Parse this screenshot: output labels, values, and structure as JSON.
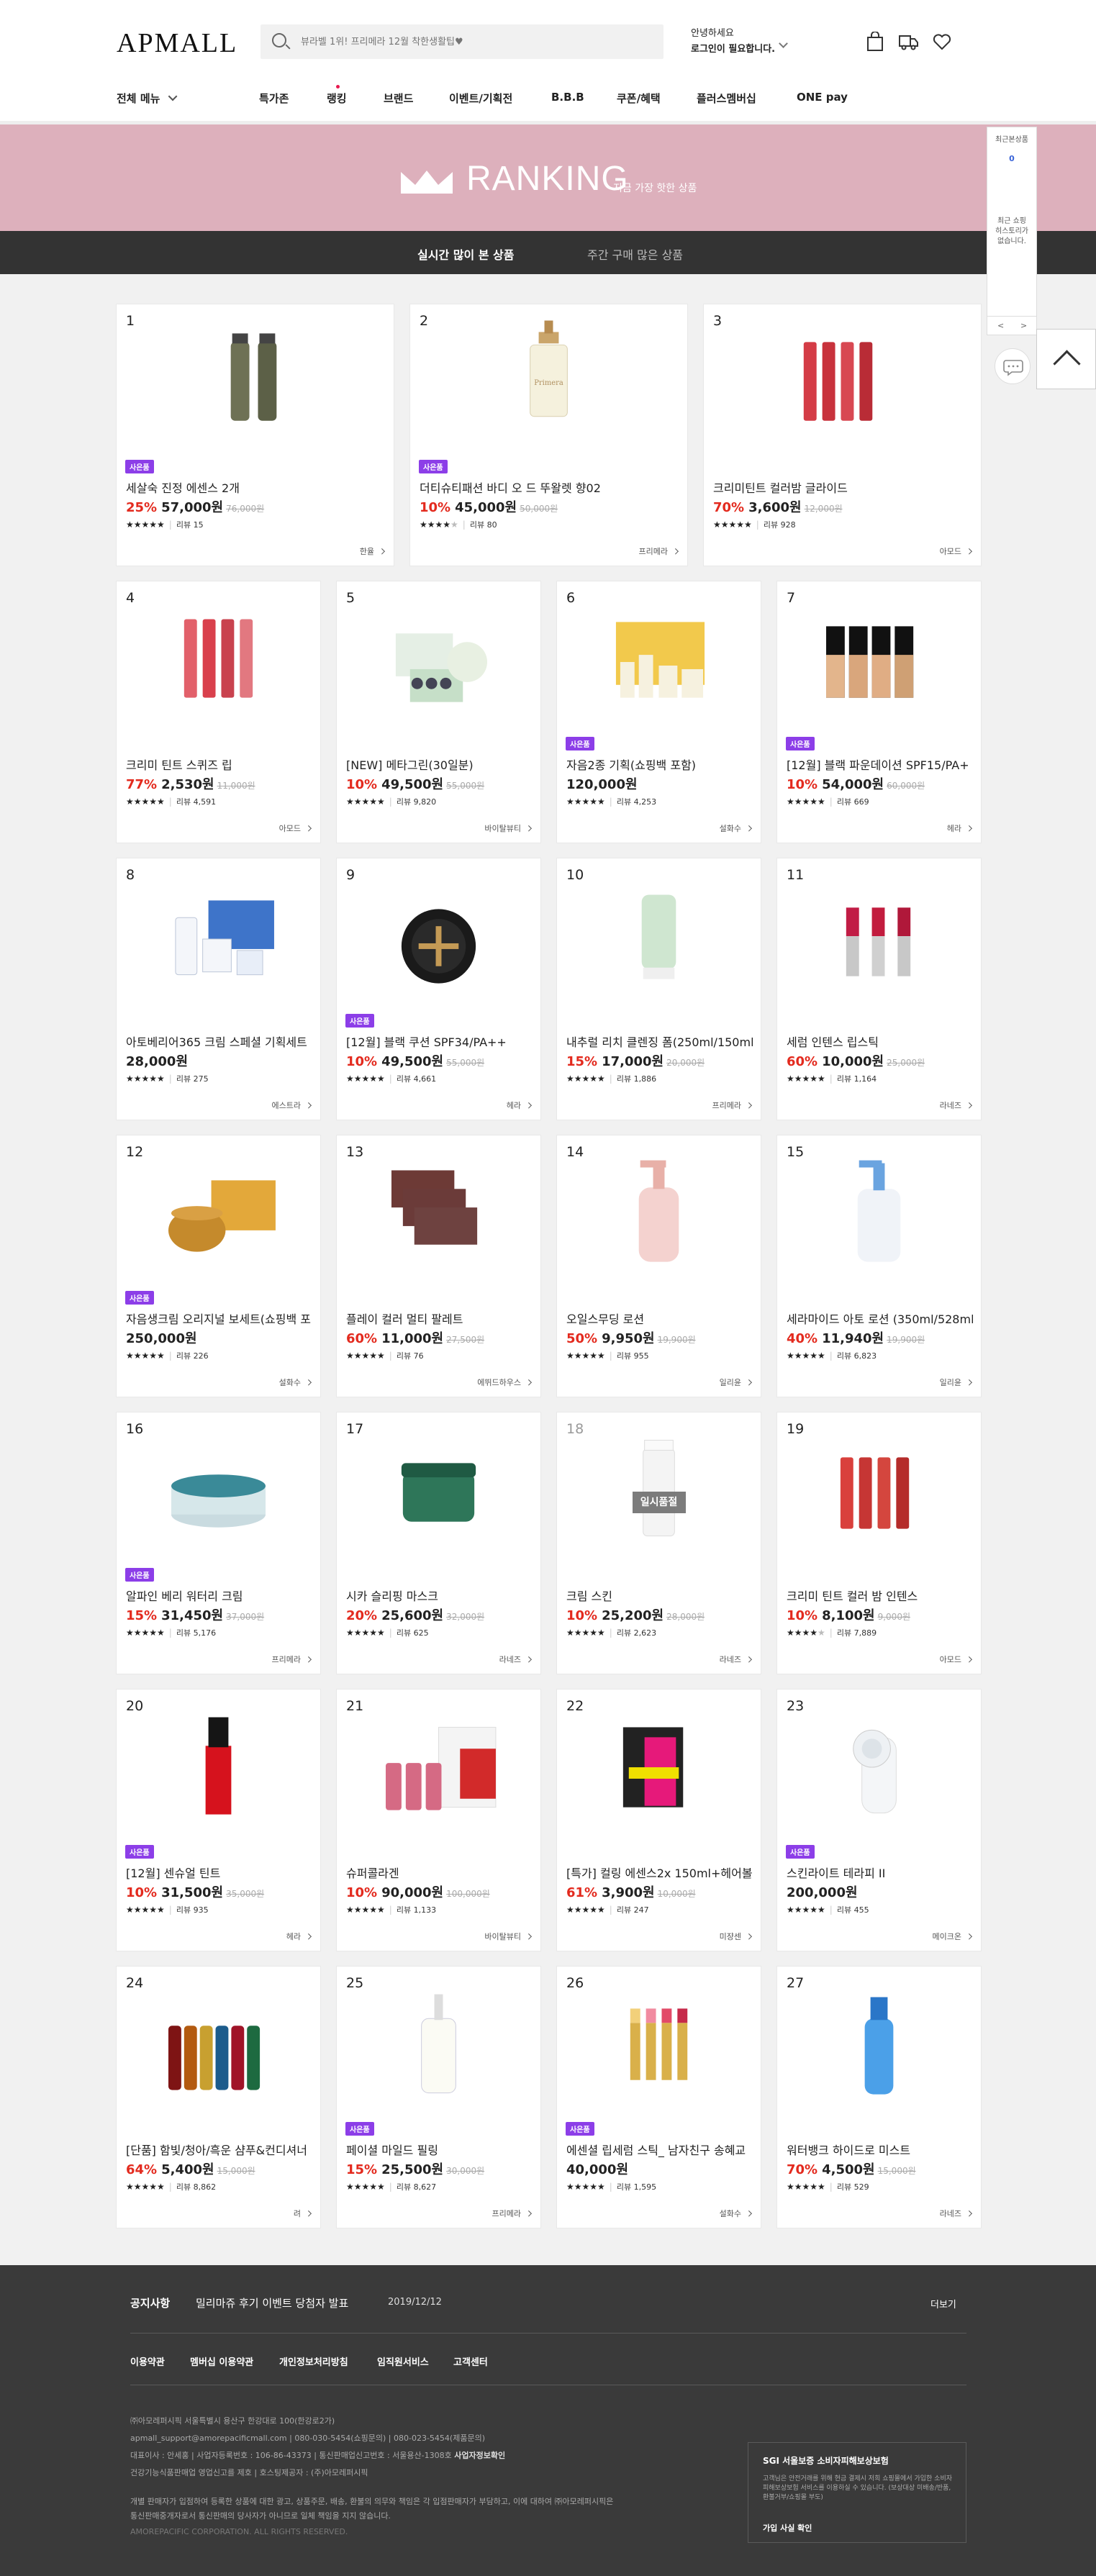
{
  "header": {
    "logo": "APMALL",
    "search_placeholder": "뷰라벨 1위! 프리메라 12월 착한생활팁♥",
    "login_line1": "안녕하세요",
    "login_line2": "로그인이 필요합니다.",
    "icons": [
      "bag-icon",
      "delivery-truck-icon",
      "heart-icon"
    ]
  },
  "gnb": {
    "all_menu": "전체 메뉴",
    "items": [
      "특가존",
      "랭킹",
      "브랜드",
      "이벤트/기획전",
      "B.B.B",
      "쿠폰/혜택",
      "플러스멤버십",
      "ONE pay"
    ]
  },
  "banner": {
    "title": "RANKING",
    "subtitle": "지금 가장 핫한 상품"
  },
  "tabs": [
    "실시간 많이 본 상품",
    "주간 구매 많은 상품"
  ],
  "recent": {
    "title": "최근본상품",
    "count": "0",
    "empty1": "최근 쇼핑",
    "empty2": "히스토리가",
    "empty3": "없습니다.",
    "prev": "<",
    "next": ">"
  },
  "products": [
    {
      "rank": "1",
      "name": "세살숙 진정 에센스 2개",
      "disc": "25%",
      "price": "57,000원",
      "orig": "76,000원",
      "stars": 5,
      "reviews": "리뷰 15",
      "brand": "한율",
      "tag": "사은품"
    },
    {
      "rank": "2",
      "name": "더티슈티패션 바디 오 드 뚜왈렛 향02",
      "disc": "10%",
      "price": "45,000원",
      "orig": "50,000원",
      "stars": 4,
      "reviews": "리뷰 80",
      "brand": "프리메라",
      "tag": "사은품"
    },
    {
      "rank": "3",
      "name": "크리미틴트 컬러밤 글라이드",
      "disc": "70%",
      "price": "3,600원",
      "orig": "12,000원",
      "stars": 5,
      "reviews": "리뷰 928",
      "brand": "아모드",
      "tag": ""
    },
    {
      "rank": "4",
      "name": "크리미 틴트 스퀴즈 립",
      "disc": "77%",
      "price": "2,530원",
      "orig": "11,000원",
      "stars": 5,
      "reviews": "리뷰 4,591",
      "brand": "아모드",
      "tag": ""
    },
    {
      "rank": "5",
      "name": "[NEW] 메타그린(30일분)",
      "disc": "10%",
      "price": "49,500원",
      "orig": "55,000원",
      "stars": 5,
      "reviews": "리뷰 9,820",
      "brand": "바이탈뷰티",
      "tag": ""
    },
    {
      "rank": "6",
      "name": "자음2종 기획(쇼핑백 포함)",
      "disc": "",
      "price": "120,000원",
      "orig": "",
      "stars": 5,
      "reviews": "리뷰 4,253",
      "brand": "설화수",
      "tag": "사은품"
    },
    {
      "rank": "7",
      "name": "[12월] 블랙 파운데이션 SPF15/PA+",
      "disc": "10%",
      "price": "54,000원",
      "orig": "60,000원",
      "stars": 5,
      "reviews": "리뷰 669",
      "brand": "헤라",
      "tag": "사은품"
    },
    {
      "rank": "8",
      "name": "아토베리어365 크림 스페셜 기획세트",
      "disc": "",
      "price": "28,000원",
      "orig": "",
      "stars": 5,
      "reviews": "리뷰 275",
      "brand": "에스트라",
      "tag": ""
    },
    {
      "rank": "9",
      "name": "[12월] 블랙 쿠션 SPF34/PA++",
      "disc": "10%",
      "price": "49,500원",
      "orig": "55,000원",
      "stars": 5,
      "reviews": "리뷰 4,661",
      "brand": "헤라",
      "tag": "사은품"
    },
    {
      "rank": "10",
      "name": "내추럴 리치 클렌징 폼(250ml/150ml)",
      "disc": "15%",
      "price": "17,000원",
      "orig": "20,000원",
      "stars": 5,
      "reviews": "리뷰 1,886",
      "brand": "프리메라",
      "tag": ""
    },
    {
      "rank": "11",
      "name": "세럼 인텐스 립스틱",
      "disc": "60%",
      "price": "10,000원",
      "orig": "25,000원",
      "stars": 5,
      "reviews": "리뷰 1,164",
      "brand": "라네즈",
      "tag": ""
    },
    {
      "rank": "12",
      "name": "자음생크림 오리지널 보세트(쇼핑백 포",
      "disc": "",
      "price": "250,000원",
      "orig": "",
      "stars": 5,
      "reviews": "리뷰 226",
      "brand": "설화수",
      "tag": "사은품"
    },
    {
      "rank": "13",
      "name": "플레이 컬러 멀티 팔레트",
      "disc": "60%",
      "price": "11,000원",
      "orig": "27,500원",
      "stars": 5,
      "reviews": "리뷰 76",
      "brand": "에뛰드하우스",
      "tag": ""
    },
    {
      "rank": "14",
      "name": "오일스무딩 로션",
      "disc": "50%",
      "price": "9,950원",
      "orig": "19,900원",
      "stars": 5,
      "reviews": "리뷰 955",
      "brand": "일리윤",
      "tag": ""
    },
    {
      "rank": "15",
      "name": "세라마이드 아토 로션 (350ml/528ml)",
      "disc": "40%",
      "price": "11,940원",
      "orig": "19,900원",
      "stars": 5,
      "reviews": "리뷰 6,823",
      "brand": "일리윤",
      "tag": ""
    },
    {
      "rank": "16",
      "name": "알파인 베리 워터리 크림",
      "disc": "15%",
      "price": "31,450원",
      "orig": "37,000원",
      "stars": 5,
      "reviews": "리뷰 5,176",
      "brand": "프리메라",
      "tag": "사은품"
    },
    {
      "rank": "17",
      "name": "시카 슬리핑 마스크",
      "disc": "20%",
      "price": "25,600원",
      "orig": "32,000원",
      "stars": 5,
      "reviews": "리뷰 625",
      "brand": "라네즈",
      "tag": ""
    },
    {
      "rank": "18",
      "name": "크림 스킨",
      "disc": "10%",
      "price": "25,200원",
      "orig": "28,000원",
      "stars": 5,
      "reviews": "리뷰 2,623",
      "brand": "라네즈",
      "tag": "",
      "soldout": "일시품절"
    },
    {
      "rank": "19",
      "name": "크리미 틴트 컬러 밤 인텐스",
      "disc": "10%",
      "price": "8,100원",
      "orig": "9,000원",
      "stars": 4,
      "reviews": "리뷰 7,889",
      "brand": "아모드",
      "tag": ""
    },
    {
      "rank": "20",
      "name": "[12월] 센슈얼 틴트",
      "disc": "10%",
      "price": "31,500원",
      "orig": "35,000원",
      "stars": 5,
      "reviews": "리뷰 935",
      "brand": "헤라",
      "tag": "사은품"
    },
    {
      "rank": "21",
      "name": "슈퍼콜라겐",
      "disc": "10%",
      "price": "90,000원",
      "orig": "100,000원",
      "stars": 5,
      "reviews": "리뷰 1,133",
      "brand": "바이탈뷰티",
      "tag": ""
    },
    {
      "rank": "22",
      "name": "[특가] 컬링 에센스2x 150ml+헤어볼 기",
      "disc": "61%",
      "price": "3,900원",
      "orig": "10,000원",
      "stars": 5,
      "reviews": "리뷰 247",
      "brand": "미쟝센",
      "tag": ""
    },
    {
      "rank": "23",
      "name": "스킨라이트 테라피 II",
      "disc": "",
      "price": "200,000원",
      "orig": "",
      "stars": 5,
      "reviews": "리뷰 455",
      "brand": "메이크온",
      "tag": "사은품"
    },
    {
      "rank": "24",
      "name": "[단품] 함빛/청아/흑운 샴푸&컨디셔너",
      "disc": "64%",
      "price": "5,400원",
      "orig": "15,000원",
      "stars": 5,
      "reviews": "리뷰 8,862",
      "brand": "려",
      "tag": ""
    },
    {
      "rank": "25",
      "name": "페이셜 마일드 필링",
      "disc": "15%",
      "price": "25,500원",
      "orig": "30,000원",
      "stars": 5,
      "reviews": "리뷰 8,627",
      "brand": "프리메라",
      "tag": "사은품"
    },
    {
      "rank": "26",
      "name": "에센셜 립세럼 스틱_ 남자친구 송혜교",
      "disc": "",
      "price": "40,000원",
      "orig": "",
      "stars": 5,
      "reviews": "리뷰 1,595",
      "brand": "설화수",
      "tag": "사은품"
    },
    {
      "rank": "27",
      "name": "워터뱅크 하이드로 미스트",
      "disc": "70%",
      "price": "4,500원",
      "orig": "15,000원",
      "stars": 5,
      "reviews": "리뷰 529",
      "brand": "라네즈",
      "tag": ""
    }
  ],
  "footer": {
    "notice_title": "공지사항",
    "notice_text": "밀리마쥬 후기 이벤트 당첨자 발표",
    "notice_date": "2019/12/12",
    "more": "더보기",
    "links": [
      "이용약관",
      "멤버십 이용약관",
      "개인정보처리방침",
      "임직원서비스",
      "고객센터"
    ],
    "info1": "㈜아모레퍼시픽       서울특별시 용산구 한강대로 100(한강로2가)",
    "info2": "apmall_support@amorepacificmall.com     |     080-030-5454(쇼핑문의)     |     080-023-5454(제품문의)",
    "info3": "대표이사 : 안세홍     |     사업자등록번호 : 106-86-43373     |     통신판매업신고번호 : 서울용산-1308호",
    "info3b": "사업자정보확인",
    "info4": "건강기능식품판매업 영업신고를 제호      |      호스팅제공자 : (주)아모레퍼시픽",
    "info5": "개별 판매자가 입점하여 등록한 상품에 대한 광고, 상품주문, 배송, 환불의 의무와 책임은 각 입점판매자가 부담하고, 이에 대하여 ㈜아모레퍼시픽은",
    "info6": "통신판매중개자로서 통신판매의 당사자가 아니므로 일체 책임을 지지 않습니다.",
    "copyright": "AMOREPACIFIC CORPORATION. ALL RIGHTS RESERVED.",
    "sgi_title": "SGI 서울보증 소비자피해보상보험",
    "sgi_desc": "고객님은 안전거래를 위해 현금 결제시 저희 쇼핑몰에서 가입한 소비자피해보상보험 서비스를 이용하실 수 있습니다. (보상대상 미배송/반품, 환불거부/쇼핑몰 부도)",
    "sgi_btn": "가입 사실 확인"
  }
}
